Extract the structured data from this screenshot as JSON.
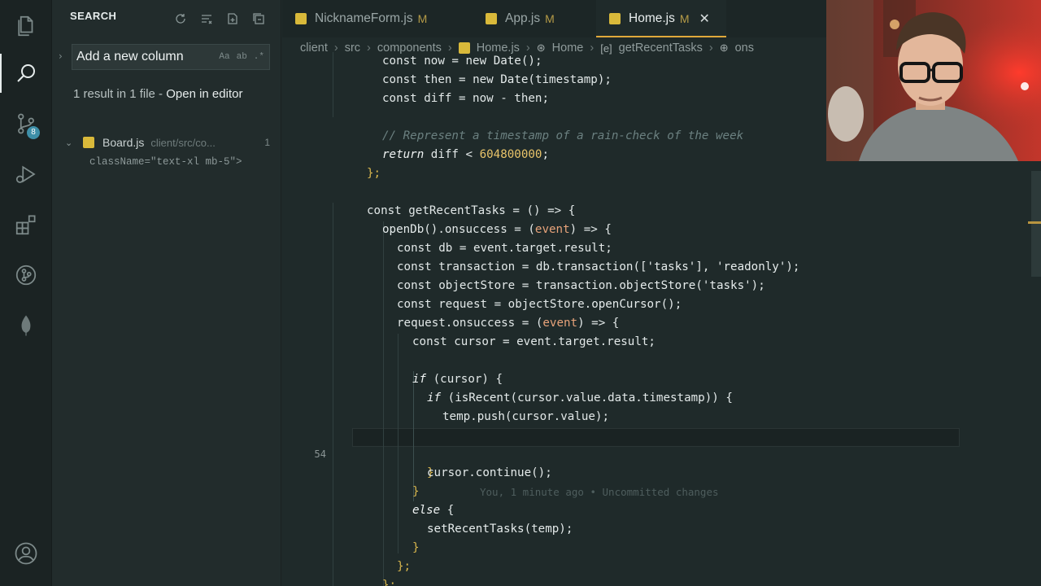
{
  "activity_bar": {
    "items": [
      {
        "name": "explorer",
        "icon": "files-icon"
      },
      {
        "name": "search",
        "icon": "search-icon",
        "active": true
      },
      {
        "name": "source-control",
        "icon": "source-control-icon",
        "badge": "8"
      },
      {
        "name": "run-debug",
        "icon": "run-debug-icon"
      },
      {
        "name": "extensions",
        "icon": "extensions-icon"
      },
      {
        "name": "git-graph",
        "icon": "git-graph-icon"
      },
      {
        "name": "mongodb",
        "icon": "leaf-icon"
      },
      {
        "name": "accounts",
        "icon": "account-icon"
      }
    ]
  },
  "sidebar": {
    "title": "SEARCH",
    "search_value": "Add a new column",
    "search_options": [
      "Aa",
      "ab",
      ".*"
    ],
    "summary": "1 result in 1 file - ",
    "open_in_editor": "Open in editor",
    "result_file": {
      "name": "Board.js",
      "path": "client/src/co...",
      "count": "1"
    },
    "match_preview": "className=\"text-xl mb-5\">"
  },
  "tabs": [
    {
      "label": "NicknameForm.js",
      "modified": "M",
      "active": false
    },
    {
      "label": "App.js",
      "modified": "M",
      "active": false
    },
    {
      "label": "Home.js",
      "modified": "M",
      "active": true,
      "close": "✕"
    }
  ],
  "breadcrumb": {
    "parts": [
      "client",
      "src",
      "components",
      "Home.js",
      "Home",
      "getRecentTasks",
      "ons"
    ]
  },
  "editor": {
    "current_line_number": "54",
    "git_blame": "You, 1 minute ago • Uncommitted changes",
    "comment": "// Represent a timestamp of a rain-check of the week"
  },
  "colors": {
    "accent": "#e0a83a",
    "js_icon": "#d9b93a",
    "number": "#e9c46a",
    "param": "#e8a37a",
    "editor_bg": "#1f2a2a"
  }
}
